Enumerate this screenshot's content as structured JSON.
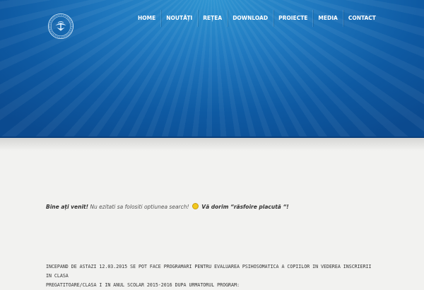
{
  "nav": {
    "items": [
      "HOME",
      "NOUTĂȚI",
      "REȚEA",
      "DOWNLOAD",
      "PROIECTE",
      "MEDIA",
      "CONTACT"
    ]
  },
  "logo": {
    "icon": "institution-seal-icon"
  },
  "welcome": {
    "greeting": "Bine ați venit!",
    "hint": "Nu ezitati sa folositi optiunea search!",
    "smiley_icon": "smiley-icon",
    "wish": "Vă dorim “răsfoire placută “!"
  },
  "announcement": {
    "line1": "INCEPAND DE ASTAZI 12.03.2015 SE POT FACE PROGRAMARI PENTRU EVALUAREA PSIHOSOMATICA A COPIILOR IN VEDEREA INSCRIERII IN CLASA",
    "line2": "PREGATITOARE/CLASA I IN ANUL SCOLAR 2015-2016 DUPA URMATORUL PROGRAM:"
  },
  "colors": {
    "header_top": "#2f95d2",
    "header_bottom": "#0b4a8f",
    "page_background": "#f2f2f0"
  }
}
